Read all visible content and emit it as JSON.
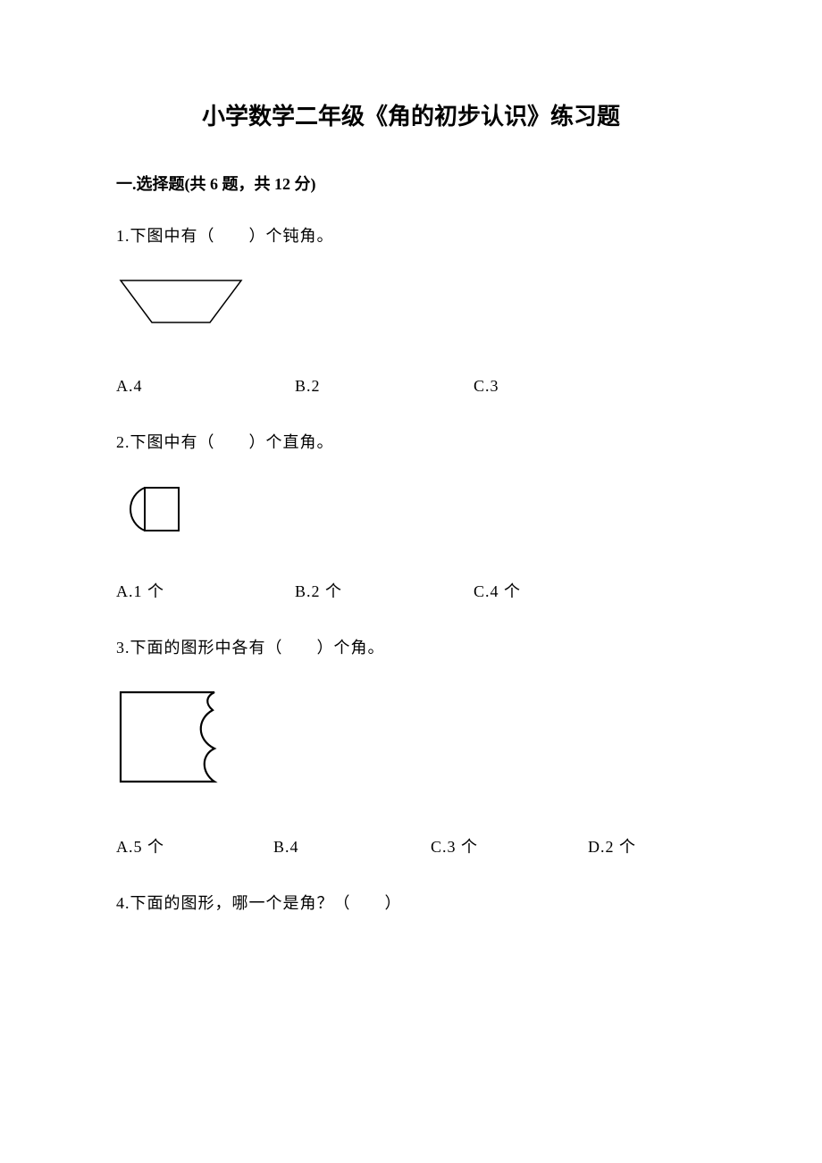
{
  "title": "小学数学二年级《角的初步认识》练习题",
  "section": "一.选择题(共 6 题，共 12 分)",
  "q1": {
    "text": "1.下图中有（  ）个钝角。",
    "A": "A.4",
    "B": "B.2",
    "C": "C.3"
  },
  "q2": {
    "text": "2.下图中有（  ）个直角。",
    "A": "A.1 个",
    "B": "B.2 个",
    "C": "C.4 个"
  },
  "q3": {
    "text": "3.下面的图形中各有（  ）个角。",
    "A": "A.5 个",
    "B": "B.4",
    "C": "C.3 个",
    "D": "D.2 个"
  },
  "q4": {
    "text": "4.下面的图形，哪一个是角？（  ）"
  }
}
